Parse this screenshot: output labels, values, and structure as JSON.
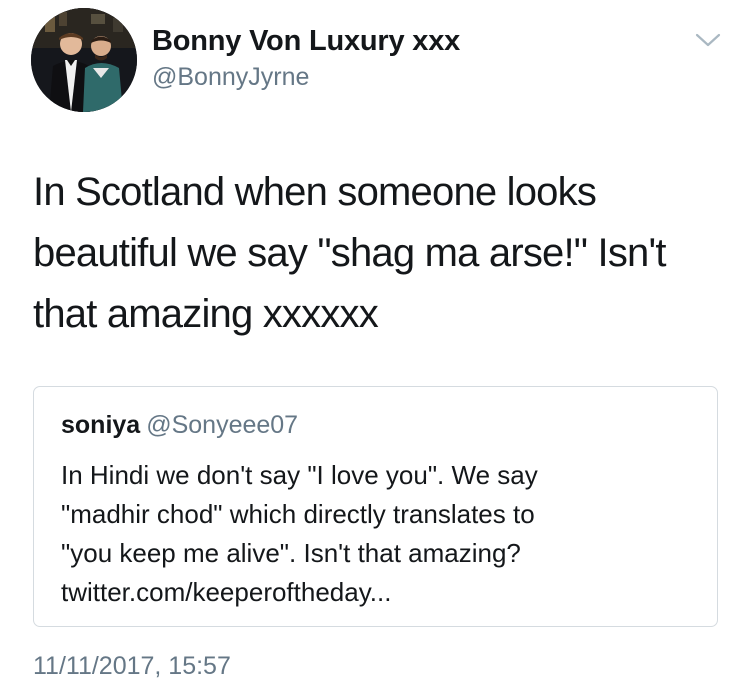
{
  "author": {
    "display_name": "Bonny Von Luxury xxx",
    "handle": "@BonnyJyrne"
  },
  "tweet": {
    "text": "In Scotland when someone looks beautiful we say \"shag ma arse!\" Isn't that amazing xxxxxx",
    "timestamp": "11/11/2017, 15:57"
  },
  "quoted_tweet": {
    "display_name": "soniya",
    "handle": "@Sonyeee07",
    "lines": [
      "In Hindi we don't say \"I love you\". We say",
      "\"madhir chod\" which directly translates to",
      "\"you keep me alive\". Isn't that amazing?",
      "twitter.com/keeperoftheday..."
    ]
  },
  "icons": {
    "menu": "chevron-down-icon"
  },
  "colors": {
    "primary_text": "#14171a",
    "secondary_text": "#657786",
    "card_border": "#d5dbe0",
    "background": "#ffffff"
  }
}
